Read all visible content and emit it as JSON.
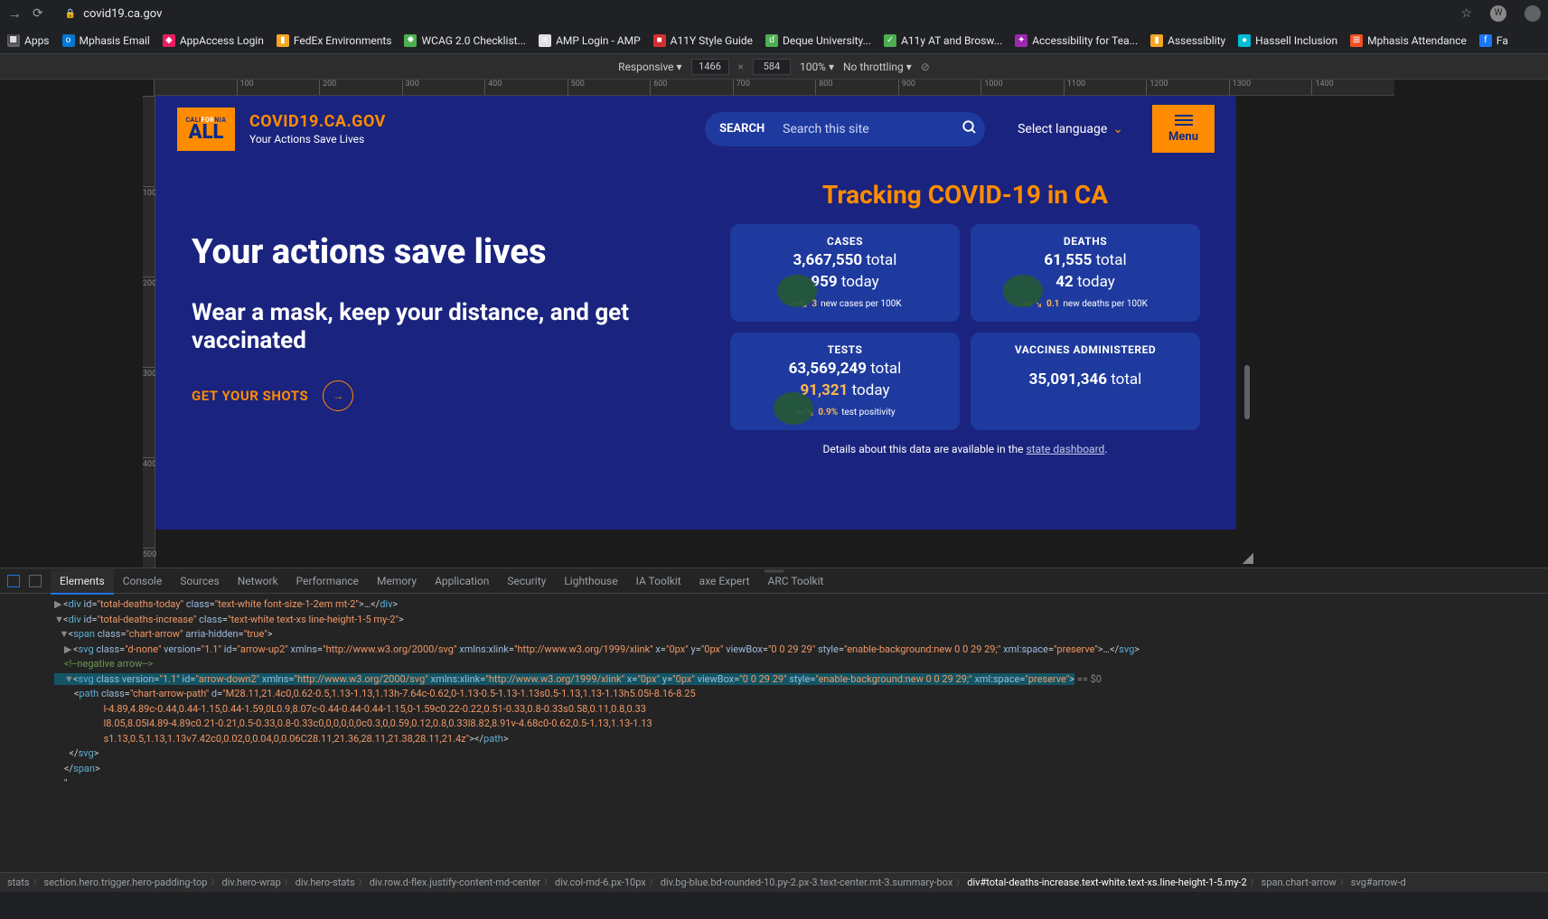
{
  "browser": {
    "url": "covid19.ca.gov",
    "bookmarks": [
      {
        "icon": "🔲",
        "color": "#5f6368",
        "label": "Apps"
      },
      {
        "icon": "o",
        "color": "#0078d4",
        "label": "Mphasis Email"
      },
      {
        "icon": "◆",
        "color": "#e91e63",
        "label": "AppAccess Login"
      },
      {
        "icon": "▮",
        "color": "#f5a623",
        "label": "FedEx Environments"
      },
      {
        "icon": "✸",
        "color": "#4caf50",
        "label": "WCAG 2.0 Checklist..."
      },
      {
        "icon": "≡",
        "color": "#e0e0e0",
        "label": "AMP Login - AMP"
      },
      {
        "icon": "■",
        "color": "#d32f2f",
        "label": "A11Y Style Guide"
      },
      {
        "icon": "ɗ",
        "color": "#4caf50",
        "label": "Deque University..."
      },
      {
        "icon": "✓",
        "color": "#4caf50",
        "label": "A11y AT and Brosw..."
      },
      {
        "icon": "✦",
        "color": "#9c27b0",
        "label": "Accessibility for Tea..."
      },
      {
        "icon": "▮",
        "color": "#f5a623",
        "label": "Assessiblity"
      },
      {
        "icon": "●",
        "color": "#00bcd4",
        "label": "Hassell Inclusion"
      },
      {
        "icon": "⊞",
        "color": "#f25022",
        "label": "Mphasis Attendance"
      },
      {
        "icon": "f",
        "color": "#1877f2",
        "label": "Fa"
      }
    ]
  },
  "device_toolbar": {
    "mode": "Responsive",
    "width": "1466",
    "height": "584",
    "zoom": "100%",
    "throttle": "No throttling"
  },
  "ruler_h": [
    "",
    "100",
    "200",
    "300",
    "400",
    "500",
    "600",
    "700",
    "800",
    "900",
    "1000",
    "1100",
    "1200",
    "1300",
    "1400"
  ],
  "ruler_v": [
    "",
    "100",
    "200",
    "300",
    "400",
    "500"
  ],
  "page": {
    "logo_top": "CALIFORNIA",
    "logo_all": "ALL",
    "site_title": "COVID19.CA.GOV",
    "tagline": "Your Actions Save Lives",
    "search_label": "SEARCH",
    "search_placeholder": "Search this site",
    "lang": "Select language",
    "menu": "Menu",
    "hero_h1": "Your actions save lives",
    "hero_sub": "Wear a mask, keep your distance, and get vaccinated",
    "cta": "GET YOUR SHOTS",
    "track_title": "Tracking COVID-19 in CA",
    "stats": {
      "cases": {
        "label": "CASES",
        "total_n": "3,667,550",
        "total_w": "total",
        "today_n": "959",
        "today_w": "today",
        "trend": "3",
        "detail": "new cases per 100K"
      },
      "deaths": {
        "label": "DEATHS",
        "total_n": "61,555",
        "total_w": "total",
        "today_n": "42",
        "today_w": "today",
        "trend": "0.1",
        "detail": "new deaths per 100K"
      },
      "tests": {
        "label": "TESTS",
        "total_n": "63,569,249",
        "total_w": "total",
        "today_n": "91,321",
        "today_w": "today",
        "trend": "0.9%",
        "detail": "test positivity"
      },
      "vax": {
        "label": "VACCINES ADMINISTERED",
        "total_n": "35,091,346",
        "total_w": "total"
      }
    },
    "details_pre": "Details about this data are available in the ",
    "details_link": "state dashboard"
  },
  "devtools": {
    "tabs": [
      "Elements",
      "Console",
      "Sources",
      "Network",
      "Performance",
      "Memory",
      "Application",
      "Security",
      "Lighthouse",
      "IA Toolkit",
      "axe Expert",
      "ARC Toolkit"
    ],
    "active_tab": "Elements",
    "breadcrumb": [
      "stats",
      "section.hero.trigger.hero-padding-top",
      "div.hero-wrap",
      "div.hero-stats",
      "div.row.d-flex.justify-content-md-center",
      "div.col-md-6.px-10px",
      "div.bg-blue.bd-rounded-10.py-2.px-3.text-center.mt-3.summary-box",
      "div#total-deaths-increase.text-white.text-xs.line-height-1-5.my-2",
      "span.chart-arrow",
      "svg#arrow-d"
    ]
  }
}
